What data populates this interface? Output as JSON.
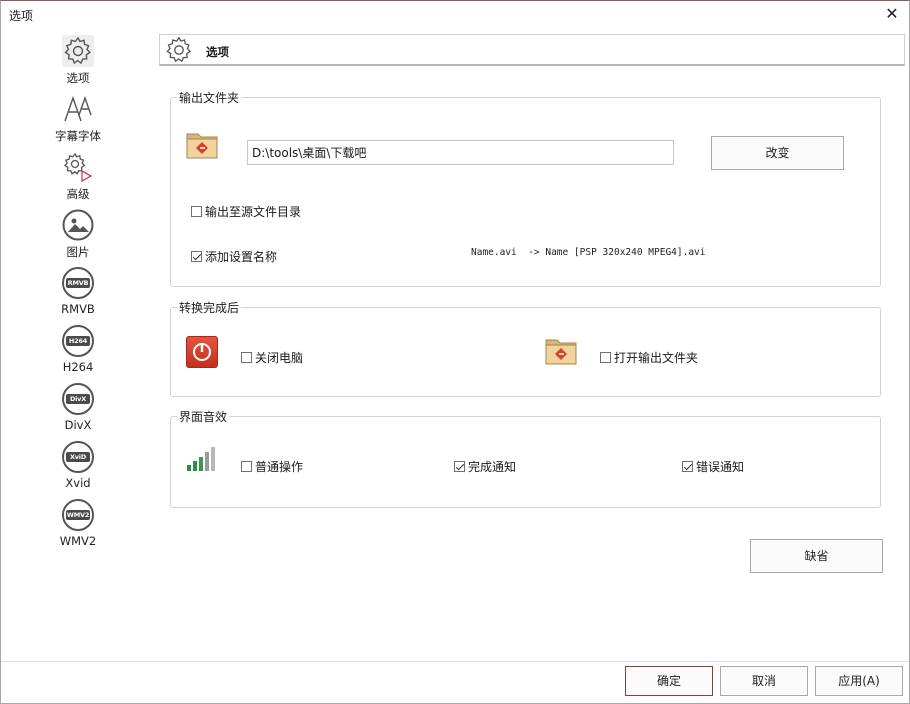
{
  "window": {
    "title": "选项"
  },
  "sidebar": {
    "items": [
      {
        "label": "选项",
        "icon": "gear-icon"
      },
      {
        "label": "字幕字体",
        "icon": "font-icon"
      },
      {
        "label": "高级",
        "icon": "advanced-gear-icon"
      },
      {
        "label": "图片",
        "icon": "picture-icon"
      },
      {
        "label": "RMVB",
        "icon": "rmvb-icon",
        "badge": "RMVB"
      },
      {
        "label": "H264",
        "icon": "h264-icon",
        "badge": "H264"
      },
      {
        "label": "DivX",
        "icon": "divx-icon",
        "badge": "DivX"
      },
      {
        "label": "Xvid",
        "icon": "xvid-icon",
        "badge": "XviD"
      },
      {
        "label": "WMV2",
        "icon": "wmv2-icon",
        "badge": "WMV2"
      }
    ]
  },
  "header": {
    "title": "选项"
  },
  "output_folder": {
    "title": "输出文件夹",
    "path": "D:\\tools\\桌面\\下载吧",
    "change_label": "改变",
    "output_to_source_label": "输出至源文件目录",
    "output_to_source_checked": false,
    "add_name_label": "添加设置名称",
    "add_name_checked": true,
    "name_example": "Name.avi  -> Name [PSP 320x240 MPEG4].avi"
  },
  "after_convert": {
    "title": "转换完成后",
    "shutdown_label": "关闭电脑",
    "shutdown_checked": false,
    "open_folder_label": "打开输出文件夹",
    "open_folder_checked": false
  },
  "sound": {
    "title": "界面音效",
    "normal_label": "普通操作",
    "normal_checked": false,
    "done_label": "完成通知",
    "done_checked": true,
    "error_label": "错误通知",
    "error_checked": true
  },
  "default_label": "缺省",
  "footer": {
    "ok_label": "确定",
    "cancel_label": "取消",
    "apply_label": "应用(A)"
  },
  "colors": {
    "accent": "#8a3b3b",
    "folder": "#e6c98f",
    "power": "#d6402b"
  }
}
